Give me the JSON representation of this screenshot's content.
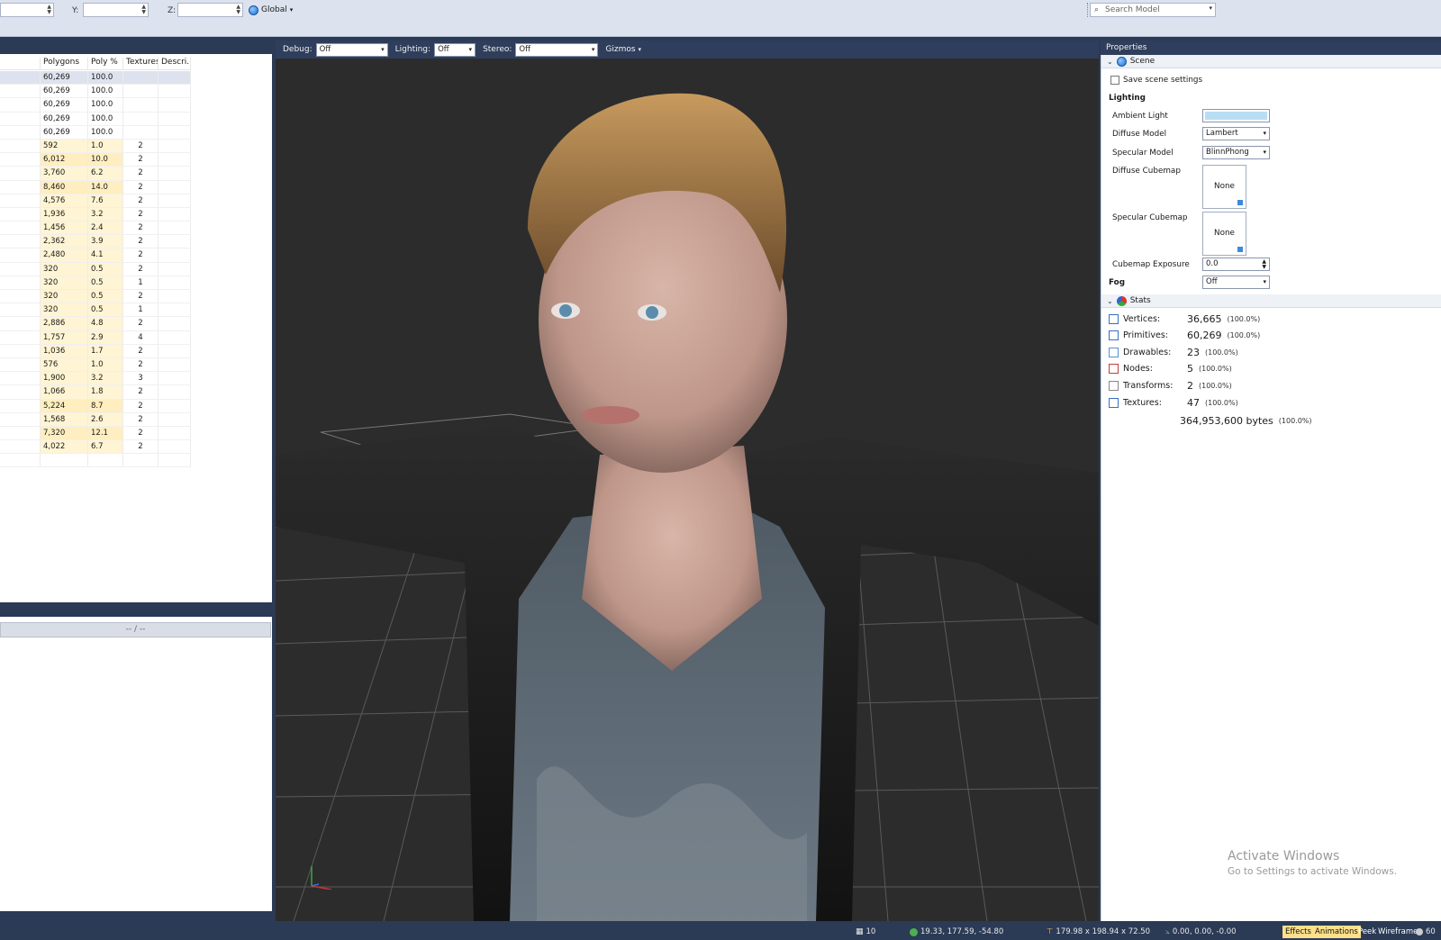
{
  "toolbar": {
    "y_label": "Y:",
    "z_label": "Z:",
    "space_label": "Global",
    "search_placeholder": "Search Model"
  },
  "table": {
    "columns": [
      "",
      "Polygons",
      "Poly %",
      "Textures",
      "Descri..."
    ],
    "rows": [
      {
        "polygons": "60,269",
        "pct": "100.0",
        "tex": ""
      },
      {
        "polygons": "60,269",
        "pct": "100.0",
        "tex": ""
      },
      {
        "polygons": "60,269",
        "pct": "100.0",
        "tex": ""
      },
      {
        "polygons": "60,269",
        "pct": "100.0",
        "tex": ""
      },
      {
        "polygons": "60,269",
        "pct": "100.0",
        "tex": ""
      },
      {
        "polygons": "592",
        "pct": "1.0",
        "tex": "2"
      },
      {
        "polygons": "6,012",
        "pct": "10.0",
        "tex": "2"
      },
      {
        "polygons": "3,760",
        "pct": "6.2",
        "tex": "2"
      },
      {
        "polygons": "8,460",
        "pct": "14.0",
        "tex": "2"
      },
      {
        "polygons": "4,576",
        "pct": "7.6",
        "tex": "2"
      },
      {
        "polygons": "1,936",
        "pct": "3.2",
        "tex": "2"
      },
      {
        "polygons": "1,456",
        "pct": "2.4",
        "tex": "2"
      },
      {
        "polygons": "2,362",
        "pct": "3.9",
        "tex": "2"
      },
      {
        "polygons": "2,480",
        "pct": "4.1",
        "tex": "2"
      },
      {
        "polygons": "320",
        "pct": "0.5",
        "tex": "2"
      },
      {
        "polygons": "320",
        "pct": "0.5",
        "tex": "1"
      },
      {
        "polygons": "320",
        "pct": "0.5",
        "tex": "2"
      },
      {
        "polygons": "320",
        "pct": "0.5",
        "tex": "1"
      },
      {
        "polygons": "2,886",
        "pct": "4.8",
        "tex": "2"
      },
      {
        "polygons": "1,757",
        "pct": "2.9",
        "tex": "4"
      },
      {
        "polygons": "1,036",
        "pct": "1.7",
        "tex": "2"
      },
      {
        "polygons": "576",
        "pct": "1.0",
        "tex": "2"
      },
      {
        "polygons": "1,900",
        "pct": "3.2",
        "tex": "3"
      },
      {
        "polygons": "1,066",
        "pct": "1.8",
        "tex": "2"
      },
      {
        "polygons": "5,224",
        "pct": "8.7",
        "tex": "2"
      },
      {
        "polygons": "1,568",
        "pct": "2.6",
        "tex": "2"
      },
      {
        "polygons": "7,320",
        "pct": "12.1",
        "tex": "2"
      },
      {
        "polygons": "4,022",
        "pct": "6.7",
        "tex": "2"
      }
    ]
  },
  "timeline": {
    "value": "-- / --"
  },
  "viewport_toolbar": {
    "debug_label": "Debug:",
    "debug_value": "Off",
    "lighting_label": "Lighting:",
    "lighting_value": "Off",
    "stereo_label": "Stereo:",
    "stereo_value": "Off",
    "gizmos_label": "Gizmos"
  },
  "properties": {
    "title": "Properties",
    "scene_label": "Scene",
    "save_scene_settings": "Save scene settings",
    "lighting_heading": "Lighting",
    "ambient_light_label": "Ambient Light",
    "ambient_color": "#b9def4",
    "diffuse_model_label": "Diffuse Model",
    "diffuse_model_value": "Lambert",
    "specular_model_label": "Specular Model",
    "specular_model_value": "BlinnPhong",
    "diffuse_cubemap_label": "Diffuse Cubemap",
    "diffuse_cubemap_value": "None",
    "specular_cubemap_label": "Specular Cubemap",
    "specular_cubemap_value": "None",
    "cubemap_exposure_label": "Cubemap Exposure",
    "cubemap_exposure_value": "0.0",
    "fog_label": "Fog",
    "fog_value": "Off",
    "stats_label": "Stats",
    "stats": [
      {
        "label": "Vertices:",
        "value": "36,665",
        "pct": "(100.0%)",
        "icon": "vertices-icon"
      },
      {
        "label": "Primitives:",
        "value": "60,269",
        "pct": "(100.0%)",
        "icon": "primitives-icon"
      },
      {
        "label": "Drawables:",
        "value": "23",
        "pct": "(100.0%)",
        "icon": "drawables-icon"
      },
      {
        "label": "Nodes:",
        "value": "5",
        "pct": "(100.0%)",
        "icon": "nodes-icon"
      },
      {
        "label": "Transforms:",
        "value": "2",
        "pct": "(100.0%)",
        "icon": "transforms-icon"
      },
      {
        "label": "Textures:",
        "value": "47",
        "pct": "(100.0%)",
        "icon": "textures-icon"
      }
    ],
    "texture_bytes": "364,953,600 bytes",
    "texture_bytes_pct": "(100.0%)"
  },
  "watermark": {
    "title": "Activate Windows",
    "subtitle": "Go to Settings to activate Windows."
  },
  "statusbar": {
    "count": "10",
    "position": "19.33, 177.59, -54.80",
    "size": "179.98 x 198.94 x 72.50",
    "rotation": "0.00, 0.00, -0.00",
    "effects": "Effects",
    "animations": "Animations",
    "peek": "Peek",
    "wireframe": "Wireframe",
    "fps": "60"
  }
}
